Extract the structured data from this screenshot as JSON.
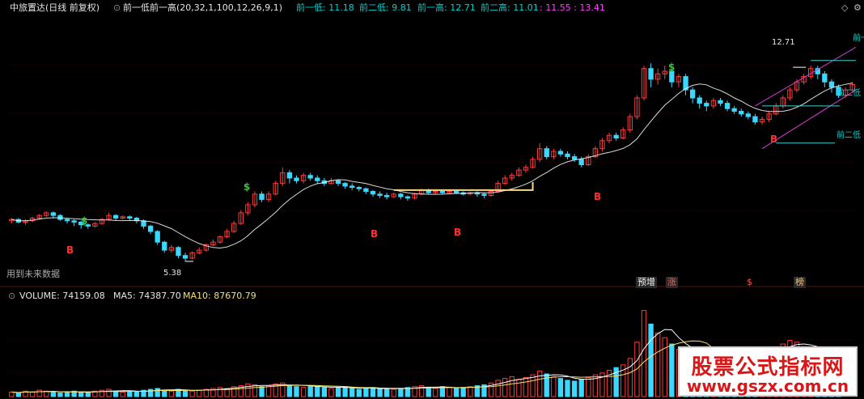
{
  "header": {
    "stock_name": "中旅置达(日线 前复权)",
    "indicator": "前一低前一高(20,32,1,100,12,26,9,1)",
    "prev_low_label": "前一低: 11.18",
    "prev2_low_label": "前二低: 9.81",
    "prev_high_label": "前一高: 12.71",
    "prev2_high_label": "前二高: 11.01",
    "extra_values": ": 11.55 : 13.41",
    "corner_icons": [
      "diamond-icon",
      "gear-icon"
    ]
  },
  "annotations": {
    "low_price": "5.38",
    "high_price": "12.71",
    "future_data": "用到未来数据",
    "line_labels": [
      "前一",
      "前二低",
      "前二低"
    ],
    "signal_b": "B",
    "signal_s": "$"
  },
  "badges": [
    {
      "text": "预增",
      "color": "#f0f0f0",
      "bg": "#2a2a2a"
    },
    {
      "text": "涨",
      "color": "#ff5050",
      "bg": "#2a2a2a"
    },
    {
      "text": "$",
      "color": "#ff5050",
      "bg": "#000000"
    },
    {
      "text": "榜",
      "color": "#f0c080",
      "bg": "#2a2a2a"
    }
  ],
  "volume": {
    "volume_label": "VOLUME: 74159.08",
    "ma5_label": "MA5: 74387.70",
    "ma10_label": "MA10: 87670.79"
  },
  "watermark": {
    "title": "股票公式指标网",
    "url": "www.gszx.com.cn"
  },
  "colors": {
    "up": "#ff3b3b",
    "down": "#3ad7ff",
    "ma_line": "#ffffff",
    "channel": "#d040d0",
    "level_line": "#40d0d0",
    "box": "#f5d78a",
    "signal_b": "#ff3030",
    "signal_s": "#40c040"
  },
  "chart_data": {
    "type": "candlestick",
    "y_range": [
      4.5,
      14.5
    ],
    "candles": [
      [
        6.9,
        6.95,
        6.8,
        7.0
      ],
      [
        6.95,
        6.85,
        6.8,
        7.0
      ],
      [
        6.85,
        6.9,
        6.75,
        6.95
      ],
      [
        6.9,
        7.0,
        6.85,
        7.05
      ],
      [
        7.0,
        7.1,
        6.95,
        7.15
      ],
      [
        7.1,
        7.2,
        7.05,
        7.25
      ],
      [
        7.2,
        7.1,
        7.0,
        7.25
      ],
      [
        7.1,
        6.95,
        6.9,
        7.15
      ],
      [
        6.95,
        6.9,
        6.8,
        7.0
      ],
      [
        6.9,
        6.85,
        6.7,
        6.95
      ],
      [
        6.85,
        6.75,
        6.6,
        6.9
      ],
      [
        6.75,
        6.7,
        6.6,
        6.8
      ],
      [
        6.7,
        6.8,
        6.65,
        6.85
      ],
      [
        6.8,
        6.95,
        6.75,
        7.0
      ],
      [
        6.95,
        7.1,
        6.9,
        7.2
      ],
      [
        7.1,
        7.0,
        6.9,
        7.15
      ],
      [
        7.0,
        7.05,
        6.95,
        7.1
      ],
      [
        7.05,
        7.0,
        6.9,
        7.1
      ],
      [
        7.0,
        6.9,
        6.8,
        7.05
      ],
      [
        6.9,
        6.7,
        6.6,
        6.95
      ],
      [
        6.7,
        6.5,
        6.4,
        6.75
      ],
      [
        6.5,
        6.1,
        6.0,
        6.55
      ],
      [
        6.1,
        5.8,
        5.7,
        6.15
      ],
      [
        5.8,
        5.9,
        5.7,
        6.0
      ],
      [
        5.9,
        5.6,
        5.5,
        5.95
      ],
      [
        5.6,
        5.5,
        5.38,
        5.7
      ],
      [
        5.5,
        5.7,
        5.45,
        5.75
      ],
      [
        5.7,
        5.8,
        5.65,
        5.9
      ],
      [
        5.8,
        6.0,
        5.75,
        6.05
      ],
      [
        6.0,
        6.1,
        5.95,
        6.2
      ],
      [
        6.1,
        6.3,
        6.05,
        6.35
      ],
      [
        6.3,
        6.5,
        6.25,
        6.6
      ],
      [
        6.5,
        6.8,
        6.45,
        6.9
      ],
      [
        6.8,
        7.2,
        6.75,
        7.3
      ],
      [
        7.2,
        7.5,
        7.1,
        7.6
      ],
      [
        7.5,
        7.9,
        7.4,
        8.0
      ],
      [
        7.9,
        7.7,
        7.6,
        8.0
      ],
      [
        7.7,
        7.9,
        7.6,
        8.0
      ],
      [
        7.9,
        8.3,
        7.85,
        8.4
      ],
      [
        8.3,
        8.7,
        8.2,
        8.9
      ],
      [
        8.7,
        8.5,
        8.3,
        8.8
      ],
      [
        8.5,
        8.4,
        8.3,
        8.6
      ],
      [
        8.4,
        8.6,
        8.3,
        8.7
      ],
      [
        8.6,
        8.5,
        8.4,
        8.7
      ],
      [
        8.5,
        8.4,
        8.3,
        8.6
      ],
      [
        8.4,
        8.3,
        8.2,
        8.5
      ],
      [
        8.3,
        8.4,
        8.25,
        8.5
      ],
      [
        8.4,
        8.3,
        8.2,
        8.45
      ],
      [
        8.3,
        8.2,
        8.1,
        8.35
      ],
      [
        8.2,
        8.15,
        8.05,
        8.3
      ],
      [
        8.15,
        8.1,
        8.0,
        8.2
      ],
      [
        8.1,
        8.0,
        7.9,
        8.15
      ],
      [
        8.0,
        7.9,
        7.8,
        8.05
      ],
      [
        7.9,
        7.85,
        7.75,
        8.0
      ],
      [
        7.85,
        7.8,
        7.7,
        7.95
      ],
      [
        7.8,
        7.9,
        7.75,
        7.95
      ],
      [
        7.9,
        7.8,
        7.7,
        7.95
      ],
      [
        7.8,
        7.75,
        7.65,
        7.85
      ],
      [
        7.75,
        7.9,
        7.7,
        7.95
      ],
      [
        7.9,
        8.05,
        7.85,
        8.1
      ],
      [
        8.05,
        7.95,
        7.9,
        8.1
      ],
      [
        7.95,
        8.0,
        7.9,
        8.05
      ],
      [
        8.0,
        7.95,
        7.9,
        8.05
      ],
      [
        7.95,
        8.0,
        7.9,
        8.05
      ],
      [
        8.0,
        7.95,
        7.9,
        8.05
      ],
      [
        7.95,
        7.9,
        7.85,
        8.0
      ],
      [
        7.9,
        7.95,
        7.85,
        8.0
      ],
      [
        7.95,
        7.9,
        7.8,
        8.0
      ],
      [
        7.9,
        7.85,
        7.75,
        7.95
      ],
      [
        7.85,
        8.0,
        7.8,
        8.05
      ],
      [
        8.0,
        8.3,
        7.95,
        8.4
      ],
      [
        8.3,
        8.5,
        8.25,
        8.6
      ],
      [
        8.5,
        8.6,
        8.4,
        8.7
      ],
      [
        8.6,
        8.8,
        8.55,
        8.9
      ],
      [
        8.8,
        8.9,
        8.7,
        9.0
      ],
      [
        8.9,
        9.2,
        8.85,
        9.3
      ],
      [
        9.2,
        9.6,
        9.1,
        9.8
      ],
      [
        9.6,
        9.3,
        9.2,
        9.7
      ],
      [
        9.3,
        9.5,
        9.2,
        9.6
      ],
      [
        9.5,
        9.4,
        9.3,
        9.6
      ],
      [
        9.4,
        9.3,
        9.2,
        9.5
      ],
      [
        9.3,
        9.2,
        9.1,
        9.4
      ],
      [
        9.2,
        9.0,
        8.9,
        9.3
      ],
      [
        9.0,
        9.3,
        8.95,
        9.4
      ],
      [
        9.3,
        9.6,
        9.25,
        9.7
      ],
      [
        9.6,
        9.9,
        9.5,
        10.0
      ],
      [
        9.9,
        10.1,
        9.8,
        10.2
      ],
      [
        10.1,
        10.0,
        9.9,
        10.2
      ],
      [
        10.0,
        10.3,
        9.95,
        10.4
      ],
      [
        10.3,
        10.8,
        10.2,
        10.9
      ],
      [
        10.8,
        11.5,
        10.7,
        11.6
      ],
      [
        11.5,
        12.6,
        11.4,
        12.7
      ],
      [
        12.6,
        12.2,
        11.9,
        12.8
      ],
      [
        12.2,
        12.4,
        12.0,
        12.6
      ],
      [
        12.4,
        12.5,
        12.2,
        12.71
      ],
      [
        12.5,
        12.1,
        11.9,
        12.6
      ],
      [
        12.1,
        12.3,
        11.9,
        12.4
      ],
      [
        12.3,
        11.8,
        11.6,
        12.4
      ],
      [
        11.8,
        11.5,
        11.3,
        11.9
      ],
      [
        11.5,
        11.3,
        11.1,
        11.6
      ],
      [
        11.3,
        11.2,
        11.0,
        11.4
      ],
      [
        11.2,
        11.4,
        11.1,
        11.5
      ],
      [
        11.4,
        11.3,
        11.2,
        11.5
      ],
      [
        11.3,
        11.1,
        11.0,
        11.4
      ],
      [
        11.1,
        11.0,
        10.9,
        11.2
      ],
      [
        11.0,
        10.9,
        10.8,
        11.1
      ],
      [
        10.9,
        10.8,
        10.7,
        11.0
      ],
      [
        10.8,
        10.6,
        10.5,
        10.9
      ],
      [
        10.6,
        10.7,
        10.5,
        10.8
      ],
      [
        10.7,
        10.9,
        10.6,
        11.0
      ],
      [
        10.9,
        11.2,
        10.85,
        11.3
      ],
      [
        11.2,
        11.5,
        11.1,
        11.6
      ],
      [
        11.5,
        11.8,
        11.4,
        11.9
      ],
      [
        11.8,
        12.1,
        11.7,
        12.2
      ],
      [
        12.1,
        12.3,
        12.0,
        12.4
      ],
      [
        12.3,
        12.6,
        12.2,
        12.71
      ],
      [
        12.6,
        12.4,
        12.2,
        12.7
      ],
      [
        12.4,
        12.1,
        11.9,
        12.5
      ],
      [
        12.1,
        11.9,
        11.7,
        12.2
      ],
      [
        11.9,
        11.6,
        11.5,
        12.0
      ],
      [
        11.6,
        11.8,
        11.5,
        11.9
      ],
      [
        11.8,
        12.0,
        11.7,
        12.1
      ]
    ],
    "volumes": [
      5,
      4,
      6,
      5,
      7,
      6,
      5,
      4,
      5,
      6,
      5,
      4,
      6,
      7,
      8,
      6,
      5,
      6,
      5,
      7,
      8,
      9,
      7,
      6,
      8,
      7,
      6,
      7,
      8,
      9,
      10,
      9,
      11,
      12,
      14,
      13,
      11,
      12,
      14,
      15,
      12,
      11,
      10,
      12,
      11,
      10,
      9,
      10,
      11,
      9,
      8,
      9,
      10,
      8,
      9,
      8,
      9,
      10,
      11,
      12,
      10,
      9,
      11,
      10,
      9,
      10,
      11,
      12,
      13,
      15,
      18,
      20,
      22,
      19,
      21,
      24,
      28,
      25,
      22,
      20,
      18,
      17,
      19,
      21,
      24,
      26,
      29,
      32,
      35,
      42,
      60,
      95,
      80,
      70,
      65,
      58,
      52,
      48,
      44,
      40,
      38,
      36,
      35,
      33,
      34,
      36,
      40,
      45,
      48,
      52,
      55,
      58,
      62,
      60,
      55,
      50,
      48,
      46,
      44,
      45
    ],
    "volume_max": 100
  }
}
